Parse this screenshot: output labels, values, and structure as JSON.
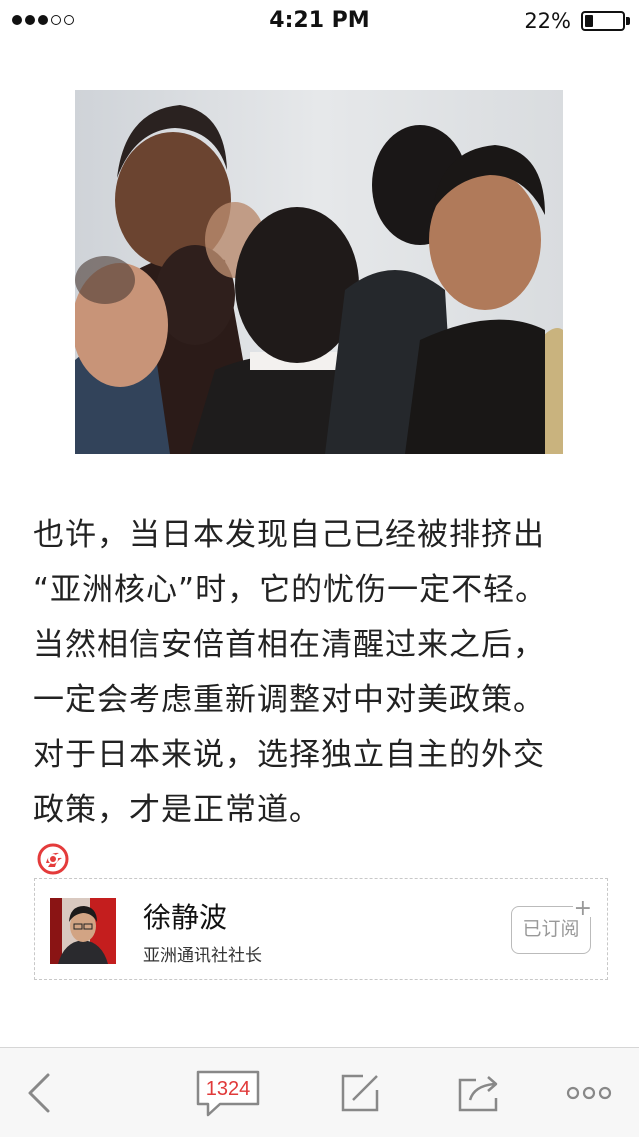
{
  "status_bar": {
    "signal_dots": [
      "full",
      "full",
      "full",
      "empty",
      "empty"
    ],
    "time": "4:21 PM",
    "battery_percent": "22%",
    "battery_level": 0.22
  },
  "photo": {
    "icon": "news-photo-image"
  },
  "article": {
    "lines": [
      "也许，当日本发现自己已经被排挤出",
      "“亚洲核心”时，它的忧伤一定不轻。",
      "当然相信安倍首相在清醒过来之后，",
      "一定会考虑重新调整对中对美政策。",
      "对于日本来说，选择独立自主的外交",
      "政策，才是正常道。"
    ],
    "end_mark_icon": "ifeng-logo-icon",
    "end_mark_color": "#e43b3b"
  },
  "author": {
    "name": "徐静波",
    "title": "亚洲通讯社社长",
    "subscribe_label": "已订阅",
    "subscribe_plus": "+"
  },
  "toolbar": {
    "back_icon": "chevron-left-icon",
    "comment_count": "1324",
    "comment_icon": "comment-bubble-icon",
    "compose_icon": "compose-icon",
    "share_icon": "share-icon",
    "more_icon": "more-dots-icon",
    "accent": "#e03a3a",
    "icon_color": "#888888"
  }
}
